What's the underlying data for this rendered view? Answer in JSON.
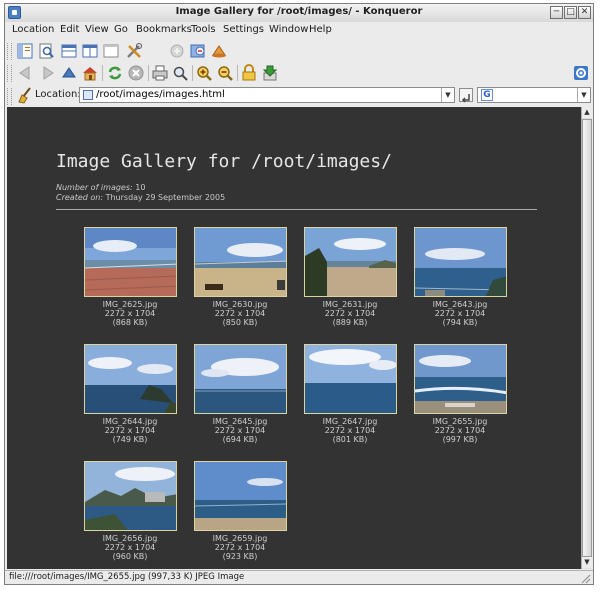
{
  "window": {
    "title": "Image Gallery for /root/images/ - Konqueror"
  },
  "menu": [
    "Location",
    "Edit",
    "View",
    "Go",
    "Bookmarks",
    "Tools",
    "Settings",
    "Window",
    "Help"
  ],
  "location": {
    "label": "Location:",
    "url": "/root/images/images.html",
    "search_engine": "G"
  },
  "page": {
    "title": "Image Gallery for /root/images/",
    "count_label": "Number of images:",
    "count_value": "10",
    "created_label": "Created on:",
    "created_value": "Thursday 29 September 2005"
  },
  "images": [
    {
      "name": "IMG_2625.jpg",
      "dims": "2272 x 1704",
      "size": "(868 KB)"
    },
    {
      "name": "IMG_2630.jpg",
      "dims": "2272 x 1704",
      "size": "(850 KB)"
    },
    {
      "name": "IMG_2631.jpg",
      "dims": "2272 x 1704",
      "size": "(889 KB)"
    },
    {
      "name": "IMG_2643.jpg",
      "dims": "2272 x 1704",
      "size": "(794 KB)"
    },
    {
      "name": "IMG_2644.jpg",
      "dims": "2272 x 1704",
      "size": "(749 KB)"
    },
    {
      "name": "IMG_2645.jpg",
      "dims": "2272 x 1704",
      "size": "(694 KB)"
    },
    {
      "name": "IMG_2647.jpg",
      "dims": "2272 x 1704",
      "size": "(801 KB)"
    },
    {
      "name": "IMG_2655.jpg",
      "dims": "2272 x 1704",
      "size": "(997 KB)"
    },
    {
      "name": "IMG_2656.jpg",
      "dims": "2272 x 1704",
      "size": "(960 KB)"
    },
    {
      "name": "IMG_2659.jpg",
      "dims": "2272 x 1704",
      "size": "(923 KB)"
    }
  ],
  "status": {
    "text": "file:///root/images/IMG_2655.jpg (997,33 K) JPEG Image"
  },
  "colors": {
    "content_bg": "#333333",
    "thumb_border": "#d9d4a0",
    "title_text": "#e6e6e6"
  }
}
